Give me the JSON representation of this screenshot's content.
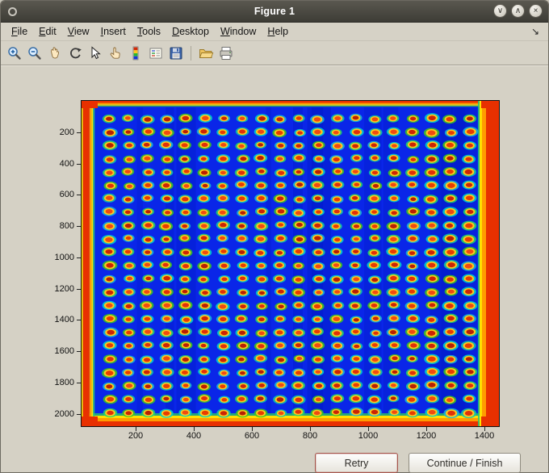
{
  "window": {
    "title": "Figure 1",
    "controls": {
      "minimize": "∨",
      "maximize": "∧",
      "close": "×"
    }
  },
  "menu": {
    "items": [
      "File",
      "Edit",
      "View",
      "Insert",
      "Tools",
      "Desktop",
      "Window",
      "Help"
    ],
    "dock_arrow": "↘"
  },
  "toolbar": {
    "items": [
      "zoom-in",
      "zoom-out",
      "pan",
      "rotate-3d",
      "data-cursor",
      "edit-plot",
      "insert-colorbar",
      "insert-legend",
      "save-figure",
      "open-file",
      "print-figure"
    ]
  },
  "figure": {
    "axes": {
      "x_ticks": [
        "200",
        "400",
        "600",
        "800",
        "1000",
        "1200",
        "1400"
      ],
      "y_ticks": [
        "200",
        "400",
        "600",
        "800",
        "1000",
        "1200",
        "1400",
        "1600",
        "1800",
        "2000"
      ]
    },
    "plot": {
      "rows": 23,
      "cols": 20,
      "background": "#0a26e8",
      "edge_hot": "#e83000",
      "dot_core": "#d42a06",
      "dot_ring": "#ffc81e",
      "dot_halo": "#14c9a0"
    }
  },
  "buttons": {
    "retry": "Retry",
    "continue_finish": "Continue / Finish"
  },
  "chart_data": {
    "type": "heatmap",
    "title": "",
    "xlabel": "",
    "ylabel": "",
    "x_range": [
      1,
      1450
    ],
    "y_range": [
      1,
      2100
    ],
    "x_ticks": [
      200,
      400,
      600,
      800,
      1000,
      1200,
      1400
    ],
    "y_ticks": [
      200,
      400,
      600,
      800,
      1000,
      1200,
      1400,
      1600,
      1800,
      2000
    ],
    "grid": {
      "rows": 23,
      "cols": 20
    },
    "colormap": "jet",
    "description": "Pseudocolor (jet colormap) scan of a spotted plate/microarray: a 20-column by 23-row grid of hot spots (red-orange cores with yellow rings and cyan-green halos) on a deep blue background, with saturated red-orange hot bands along all four image edges, widest on the left and right."
  }
}
